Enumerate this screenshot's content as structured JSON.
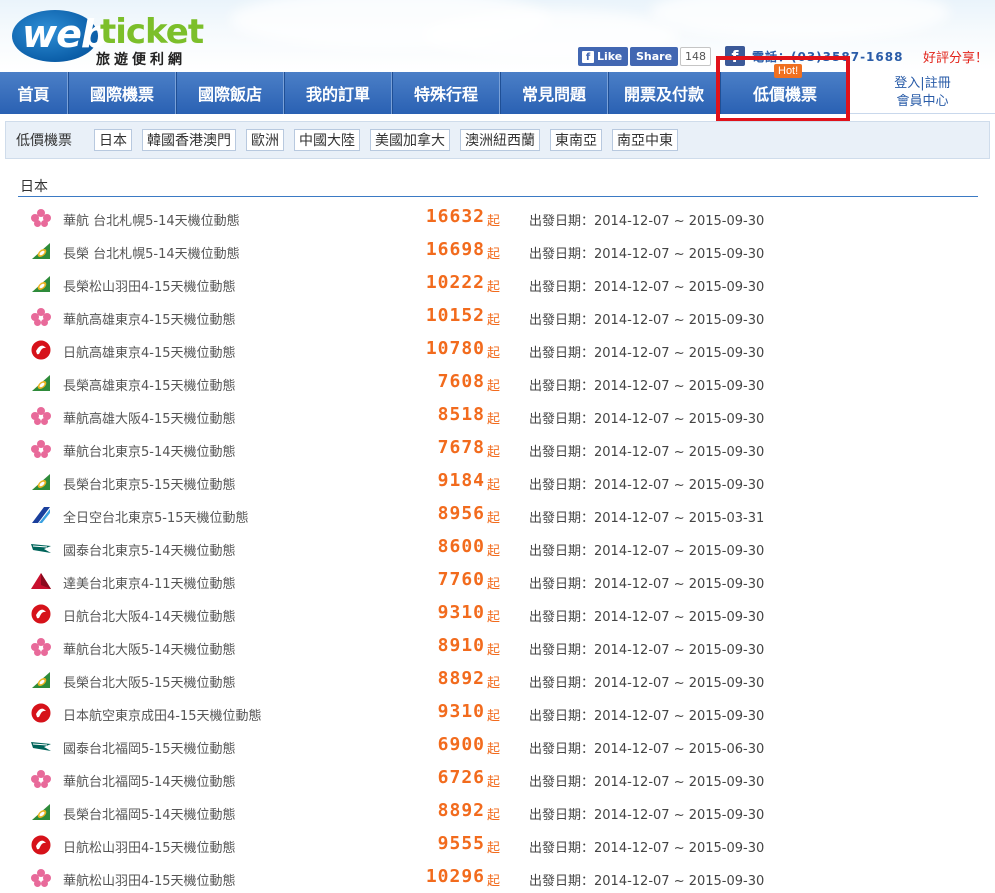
{
  "header": {
    "logo_primary": "web",
    "logo_secondary": "ticket",
    "logo_subtitle": "旅遊便利網",
    "fb_like": "Like",
    "fb_share": "Share",
    "fb_count": "148",
    "phone": "電話：(03)3587-1688",
    "share_text": "好評分享！"
  },
  "nav": {
    "items": [
      {
        "label": "首頁"
      },
      {
        "label": "國際機票"
      },
      {
        "label": "國際飯店"
      },
      {
        "label": "我的訂單"
      },
      {
        "label": "特殊行程"
      },
      {
        "label": "常見問題"
      },
      {
        "label": "開票及付款"
      },
      {
        "label": "低價機票"
      }
    ],
    "hot_badge": "Hot!",
    "login": "登入",
    "register": "註冊",
    "separator": "|",
    "member_center": "會員中心"
  },
  "subnav": {
    "title": "低價機票",
    "regions": [
      "日本",
      "韓國香港澳門",
      "歐洲",
      "中國大陸",
      "美國加拿大",
      "澳洲紐西蘭",
      "東南亞",
      "南亞中東"
    ]
  },
  "section": {
    "title": "日本",
    "price_suffix": "起",
    "date_prefix": "出發日期："
  },
  "airline_colors": {
    "china": "#e86a9a",
    "eva": "#2e8b3a",
    "jal": "#d6121a",
    "ana": "#1a3f9c",
    "cathay": "#00645a",
    "delta": "#c8102e"
  },
  "flights": [
    {
      "airline": "china",
      "icon": "china-airlines-plum-icon",
      "name": "華航 台北札幌5-14天機位動態",
      "price": "16632",
      "date": "2014-12-07 ~ 2015-09-30"
    },
    {
      "airline": "eva",
      "icon": "eva-air-icon",
      "name": "長榮 台北札幌5-14天機位動態",
      "price": "16698",
      "date": "2014-12-07 ~ 2015-09-30"
    },
    {
      "airline": "eva",
      "icon": "eva-air-icon",
      "name": "長榮松山羽田4-15天機位動態",
      "price": "10222",
      "date": "2014-12-07 ~ 2015-09-30"
    },
    {
      "airline": "china",
      "icon": "china-airlines-plum-icon",
      "name": "華航高雄東京4-15天機位動態",
      "price": "10152",
      "date": "2014-12-07 ~ 2015-09-30"
    },
    {
      "airline": "jal",
      "icon": "jal-crane-icon",
      "name": "日航高雄東京4-15天機位動態",
      "price": "10780",
      "date": "2014-12-07 ~ 2015-09-30"
    },
    {
      "airline": "eva",
      "icon": "eva-air-icon",
      "name": "長榮高雄東京4-15天機位動態",
      "price": "7608",
      "date": "2014-12-07 ~ 2015-09-30"
    },
    {
      "airline": "china",
      "icon": "china-airlines-plum-icon",
      "name": "華航高雄大阪4-15天機位動態",
      "price": "8518",
      "date": "2014-12-07 ~ 2015-09-30"
    },
    {
      "airline": "china",
      "icon": "china-airlines-plum-icon",
      "name": "華航台北東京5-14天機位動態",
      "price": "7678",
      "date": "2014-12-07 ~ 2015-09-30"
    },
    {
      "airline": "eva",
      "icon": "eva-air-icon",
      "name": "長榮台北東京5-15天機位動態",
      "price": "9184",
      "date": "2014-12-07 ~ 2015-09-30"
    },
    {
      "airline": "ana",
      "icon": "ana-stripe-icon",
      "name": "全日空台北東京5-15天機位動態",
      "price": "8956",
      "date": "2014-12-07 ~ 2015-03-31"
    },
    {
      "airline": "cathay",
      "icon": "cathay-brushwing-icon",
      "name": "國泰台北東京5-14天機位動態",
      "price": "8600",
      "date": "2014-12-07 ~ 2015-09-30"
    },
    {
      "airline": "delta",
      "icon": "delta-triangle-icon",
      "name": "達美台北東京4-11天機位動態",
      "price": "7760",
      "date": "2014-12-07 ~ 2015-09-30"
    },
    {
      "airline": "jal",
      "icon": "jal-crane-icon",
      "name": "日航台北大阪4-14天機位動態",
      "price": "9310",
      "date": "2014-12-07 ~ 2015-09-30"
    },
    {
      "airline": "china",
      "icon": "china-airlines-plum-icon",
      "name": "華航台北大阪5-14天機位動態",
      "price": "8910",
      "date": "2014-12-07 ~ 2015-09-30"
    },
    {
      "airline": "eva",
      "icon": "eva-air-icon",
      "name": "長榮台北大阪5-15天機位動態",
      "price": "8892",
      "date": "2014-12-07 ~ 2015-09-30"
    },
    {
      "airline": "jal",
      "icon": "jal-crane-icon",
      "name": "日本航空東京成田4-15天機位動態",
      "price": "9310",
      "date": "2014-12-07 ~ 2015-09-30"
    },
    {
      "airline": "cathay",
      "icon": "cathay-brushwing-icon",
      "name": "國泰台北福岡5-15天機位動態",
      "price": "6900",
      "date": "2014-12-07 ~ 2015-06-30"
    },
    {
      "airline": "china",
      "icon": "china-airlines-plum-icon",
      "name": "華航台北福岡5-14天機位動態",
      "price": "6726",
      "date": "2014-12-07 ~ 2015-09-30"
    },
    {
      "airline": "eva",
      "icon": "eva-air-icon",
      "name": "長榮台北福岡5-14天機位動態",
      "price": "8892",
      "date": "2014-12-07 ~ 2015-09-30"
    },
    {
      "airline": "jal",
      "icon": "jal-crane-icon",
      "name": "日航松山羽田4-15天機位動態",
      "price": "9555",
      "date": "2014-12-07 ~ 2015-09-30"
    },
    {
      "airline": "china",
      "icon": "china-airlines-plum-icon",
      "name": "華航松山羽田4-15天機位動態",
      "price": "10296",
      "date": "2014-12-07 ~ 2015-09-30"
    }
  ]
}
